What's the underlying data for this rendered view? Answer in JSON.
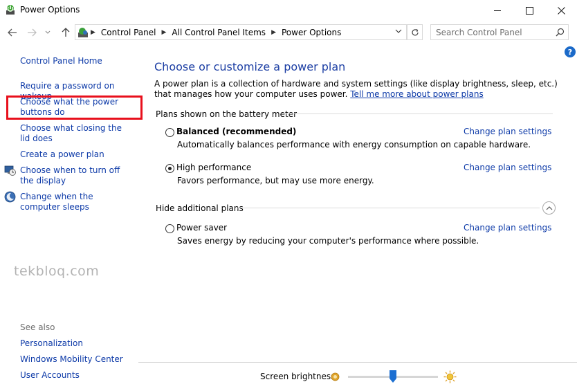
{
  "window": {
    "title": "Power Options",
    "icon": "power-options-icon",
    "controls": [
      "minimize-icon",
      "maximize-icon",
      "close-icon"
    ]
  },
  "nav": {
    "breadcrumbs": [
      "Control Panel",
      "All Control Panel Items",
      "Power Options"
    ],
    "search_placeholder": "Search Control Panel",
    "help_label": "?"
  },
  "sidebar": {
    "home": "Control Panel Home",
    "links": [
      {
        "label": "Require a password on wakeup",
        "icon": ""
      },
      {
        "label": "Choose what the power buttons do",
        "icon": "",
        "highlighted": true
      },
      {
        "label": "Choose what closing the lid does",
        "icon": ""
      },
      {
        "label": "Create a power plan",
        "icon": ""
      },
      {
        "label": "Choose when to turn off the display",
        "icon": "display-clock-icon"
      },
      {
        "label": "Change when the computer sleeps",
        "icon": "moon-sleep-icon"
      }
    ],
    "see_also": {
      "title": "See also",
      "items": [
        "Personalization",
        "Windows Mobility Center",
        "User Accounts"
      ]
    },
    "watermark": "tekbloq.com"
  },
  "main": {
    "heading": "Choose or customize a power plan",
    "description": "A power plan is a collection of hardware and system settings (like display brightness, sleep, etc.) that manages how your computer uses power.",
    "learn_more": "Tell me more about power plans",
    "battery_group": "Plans shown on the battery meter",
    "hidden_group": "Hide additional plans",
    "plans": [
      {
        "name": "Balanced (recommended)",
        "bold": true,
        "selected": false,
        "description": "Automatically balances performance with energy consumption on capable hardware.",
        "link": "Change plan settings"
      },
      {
        "name": "High performance",
        "bold": false,
        "selected": true,
        "description": "Favors performance, but may use more energy.",
        "link": "Change plan settings"
      },
      {
        "name": "Power saver",
        "bold": false,
        "selected": false,
        "description": "Saves energy by reducing your computer's performance where possible.",
        "link": "Change plan settings"
      }
    ]
  },
  "brightness": {
    "label": "Screen brightness:",
    "level_fraction": 0.5,
    "colors": {
      "thumb": "#1c6fd1",
      "accent_link": "#0d3aa8",
      "heading": "#1d3fa4",
      "highlight_box": "#e8101c"
    }
  }
}
